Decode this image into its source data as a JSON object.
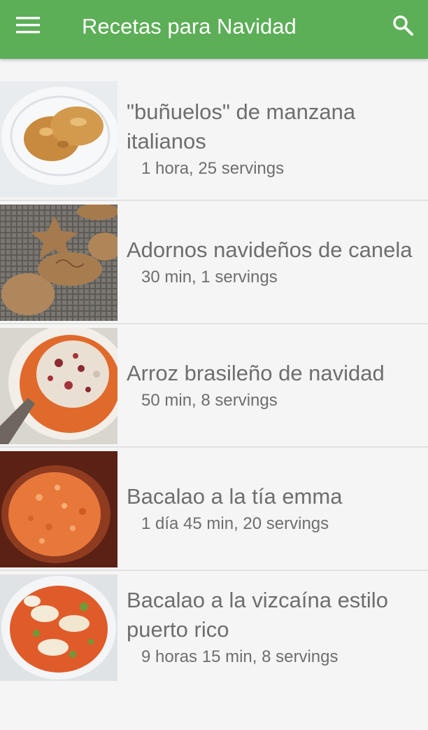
{
  "app_bar": {
    "title": "Recetas para Navidad",
    "menu_icon": "menu-icon",
    "search_icon": "search-icon",
    "color": "#5cae57"
  },
  "recipes": [
    {
      "name": "\"buñuelos\" de manzana italianos",
      "meta": "1 hora, 25 servings"
    },
    {
      "name": "Adornos navideños de canela",
      "meta": "30 min, 1 servings"
    },
    {
      "name": "Arroz brasileño de navidad",
      "meta": "50 min, 8 servings"
    },
    {
      "name": "Bacalao a la tía emma",
      "meta": "1 día 45 min, 20 servings"
    },
    {
      "name": "Bacalao a la vizcaína estilo puerto rico",
      "meta": "9 horas 15 min, 8 servings"
    }
  ]
}
